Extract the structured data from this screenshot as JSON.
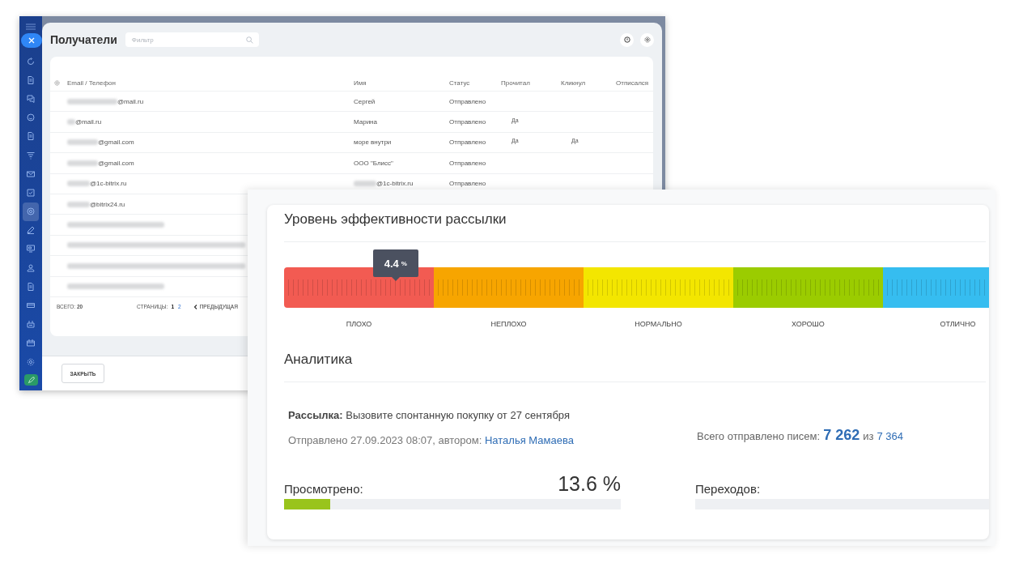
{
  "recipients_window": {
    "title": "Получатели",
    "filter": {
      "placeholder": "Фильтр"
    },
    "columns": [
      "Email / Телефон",
      "Имя",
      "Статус",
      "Прочитал",
      "Кликнул",
      "Отписался"
    ],
    "rows": [
      {
        "kind": "contact",
        "email": {
          "text": "@mail.ru",
          "redacted": true
        },
        "name": {
          "text": "Сергей",
          "redacted": false
        },
        "status": "Отправлено"
      },
      {
        "kind": "contact",
        "email": {
          "text": "@mail.ru",
          "redacted": true
        },
        "name": {
          "text": "Марина",
          "redacted": false
        },
        "status": "Отправлено",
        "read": "Да"
      },
      {
        "kind": "contact",
        "email": {
          "text": "@gmail.com",
          "redacted": true
        },
        "name": {
          "text": "море внутри",
          "redacted": false
        },
        "status": "Отправлено",
        "read": "Да",
        "clicked": "Да"
      },
      {
        "kind": "contact",
        "email": {
          "text": "@gmail.com",
          "redacted": true
        },
        "name": {
          "text": "ООО \"Блисс\"",
          "redacted": false
        },
        "status": "Отправлено"
      },
      {
        "kind": "contact",
        "email": {
          "text": "@1c-bitrix.ru",
          "redacted": true
        },
        "name": {
          "text": "@1c-bitrix.ru",
          "redacted": true
        },
        "status": "Отправлено"
      },
      {
        "kind": "contact",
        "email": {
          "text": "@bitrix24.ru",
          "redacted": true
        }
      },
      {
        "kind": "redacted"
      },
      {
        "kind": "redacted"
      },
      {
        "kind": "redacted"
      },
      {
        "kind": "redacted"
      }
    ],
    "total": "ВСЕГО: **20**",
    "pages_label": "СТРАНИЦЫ:",
    "pages": [
      {
        "label": "1",
        "selected": true
      },
      {
        "label": "2",
        "selected": false
      }
    ],
    "previous": "ПРЕДЫДУЩАЯ",
    "close_button": "ЗАКРЫТЬ"
  },
  "report_window": {
    "efficiency": {
      "title": "Уровень эффективности рассылки",
      "marker": {
        "value": "4.4",
        "unit": "%",
        "level": 0.148
      },
      "segments": [
        {
          "label": "ПЛОХО",
          "color": "#f25b52"
        },
        {
          "label": "НЕПЛОХО",
          "color": "#f7a500"
        },
        {
          "label": "НОРМАЛЬНО",
          "color": "#f3e600"
        },
        {
          "label": "ХОРОШО",
          "color": "#9bcc00"
        },
        {
          "label": "ОТЛИЧНО",
          "color": "#36bdf0"
        }
      ]
    },
    "analytics": {
      "title": "Аналитика",
      "mailing": "**Рассылка:**  Вызовите спонтанную покупку от 27 сентября",
      "sent_info": "Отправлено 27.09.2023 08:07, автором: ",
      "author": "Наталья Мамаева",
      "sent_label": "Всего отправлено писем:",
      "sent": "7 262",
      "of": "из",
      "total": "7 364",
      "metrics": [
        {
          "label": "Просмотрено:",
          "value": "13.6 %",
          "level": 0.136
        },
        {
          "label": "Переходов:",
          "level": 0
        }
      ]
    }
  }
}
